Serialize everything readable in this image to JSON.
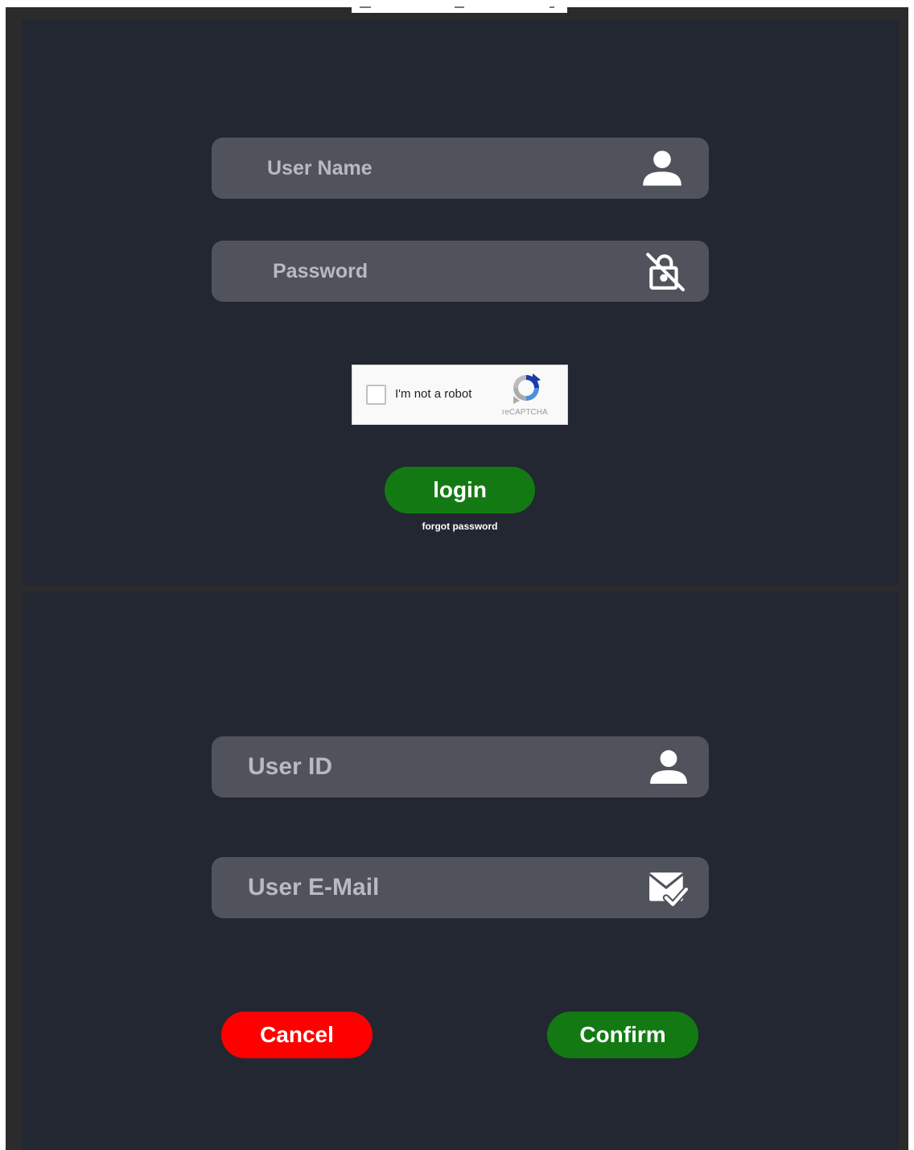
{
  "login_form": {
    "username": {
      "placeholder": "User Name",
      "icon": "user-icon"
    },
    "password": {
      "placeholder": "Password",
      "icon": "lock-off-icon"
    },
    "captcha": {
      "label": "I'm not a robot",
      "brand": "reCAPTCHA",
      "checked": false,
      "icon": "recaptcha-logo-icon"
    },
    "login_label": "login",
    "forgot_label": "forgot password"
  },
  "reset_form": {
    "user_id": {
      "placeholder": "User ID",
      "icon": "user-icon"
    },
    "user_email": {
      "placeholder": "User E-Mail",
      "icon": "mail-check-icon"
    },
    "cancel_label": "Cancel",
    "confirm_label": "Confirm"
  },
  "colors": {
    "panel_bg": "#232731",
    "field_bg": "#50535c",
    "login_green": "#137a13",
    "cancel_red": "#ff0000",
    "frame": "#2b2b2b"
  }
}
